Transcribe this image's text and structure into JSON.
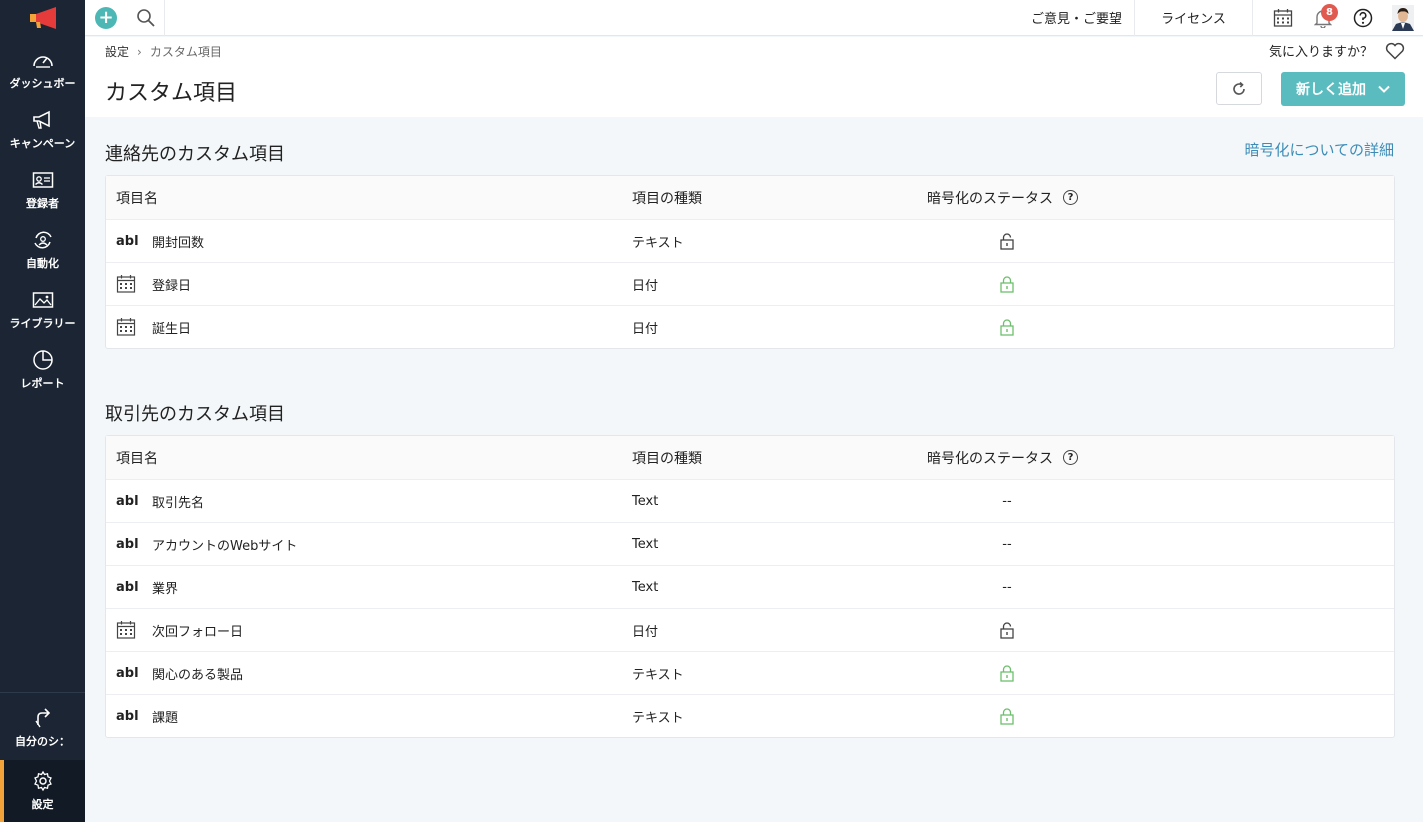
{
  "sidebar": {
    "items": [
      {
        "label": "ダッシュボー",
        "icon": "gauge-icon"
      },
      {
        "label": "キャンペーン",
        "icon": "megaphone-icon"
      },
      {
        "label": "登録者",
        "icon": "contact-card-icon"
      },
      {
        "label": "自動化",
        "icon": "automation-icon"
      },
      {
        "label": "ライブラリー",
        "icon": "image-icon"
      },
      {
        "label": "レポート",
        "icon": "pie-chart-icon"
      }
    ],
    "bottom": [
      {
        "label": "自分のシ：",
        "icon": "share-arrow-icon"
      },
      {
        "label": "設定",
        "icon": "gear-icon"
      }
    ]
  },
  "topbar": {
    "feedback": "ご意見・ご要望",
    "license": "ライセンス",
    "notifications_count": "8"
  },
  "header": {
    "breadcrumb": [
      "設定",
      "カスタム項目"
    ],
    "favorite_prompt": "気に入りますか？",
    "title": "カスタム項目",
    "add_button": "新しく追加"
  },
  "encryption_link": "暗号化についての詳細",
  "columns": {
    "name": "項目名",
    "type": "項目の種類",
    "encryption": "暗号化のステータス"
  },
  "contacts": {
    "title": "連絡先のカスタム項目",
    "rows": [
      {
        "icon": "abl",
        "name": "開封回数",
        "type": "テキスト",
        "status": "unlocked"
      },
      {
        "icon": "calendar",
        "name": "登録日",
        "type": "日付",
        "status": "locked-green"
      },
      {
        "icon": "calendar",
        "name": "誕生日",
        "type": "日付",
        "status": "locked-green"
      }
    ]
  },
  "accounts": {
    "title": "取引先のカスタム項目",
    "rows": [
      {
        "icon": "abl",
        "name": "取引先名",
        "type": "Text",
        "status": "--"
      },
      {
        "icon": "abl",
        "name": "アカウントのWebサイト",
        "type": "Text",
        "status": "--"
      },
      {
        "icon": "abl",
        "name": "業界",
        "type": "Text",
        "status": "--"
      },
      {
        "icon": "calendar",
        "name": "次回フォロー日",
        "type": "日付",
        "status": "unlocked"
      },
      {
        "icon": "abl",
        "name": "関心のある製品",
        "type": "テキスト",
        "status": "locked-green"
      },
      {
        "icon": "abl",
        "name": "課題",
        "type": "テキスト",
        "status": "locked-green"
      }
    ]
  },
  "abl_label": "abl",
  "colors": {
    "teal": "#5bbcbf",
    "sidebar": "#1b2533",
    "link": "#3d8cb8",
    "lock_green": "#6dbf6d",
    "accent": "#f2a33a"
  }
}
